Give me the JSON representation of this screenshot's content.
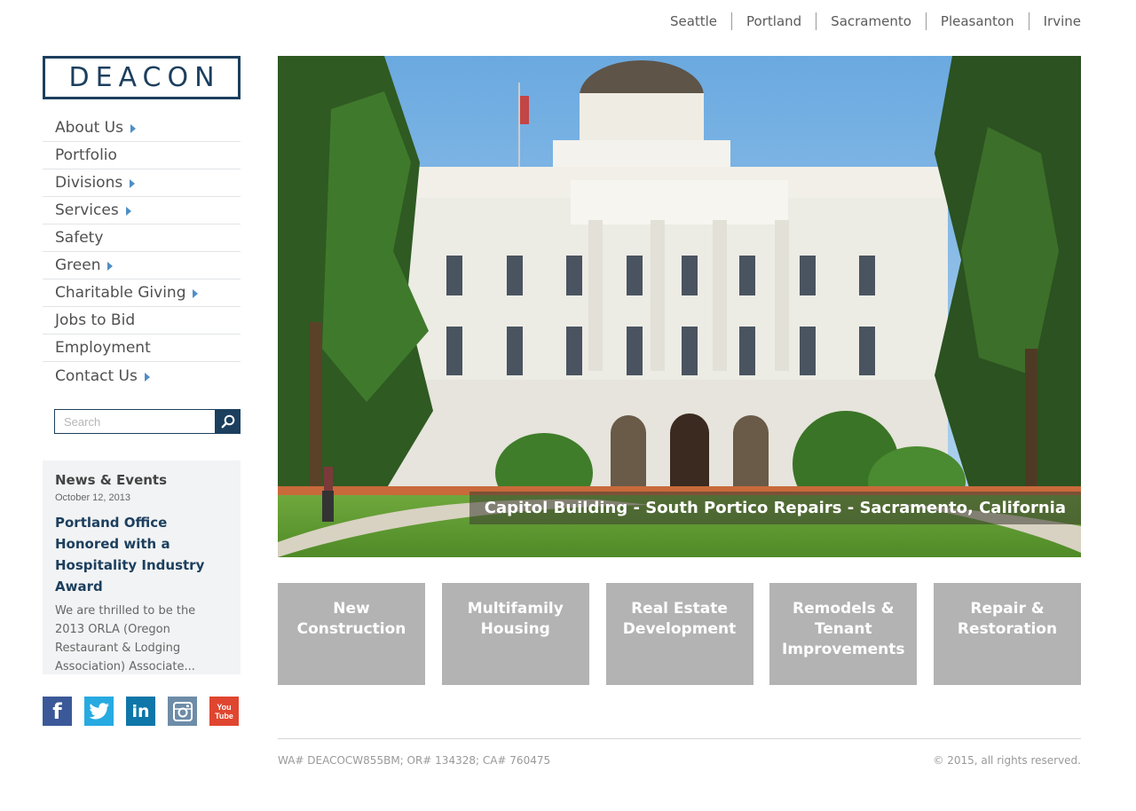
{
  "city_nav": [
    "Seattle",
    "Portland",
    "Sacramento",
    "Pleasanton",
    "Irvine"
  ],
  "logo": "DEACON",
  "sidebar": {
    "items": [
      {
        "label": "About Us",
        "has_submenu": true
      },
      {
        "label": "Portfolio",
        "has_submenu": false
      },
      {
        "label": "Divisions",
        "has_submenu": true
      },
      {
        "label": "Services",
        "has_submenu": true
      },
      {
        "label": "Safety",
        "has_submenu": false
      },
      {
        "label": "Green",
        "has_submenu": true
      },
      {
        "label": "Charitable Giving",
        "has_submenu": true
      },
      {
        "label": "Jobs to Bid",
        "has_submenu": false
      },
      {
        "label": "Employment",
        "has_submenu": false
      },
      {
        "label": "Contact Us",
        "has_submenu": true
      }
    ]
  },
  "search": {
    "placeholder": "Search",
    "value": "",
    "icon": "search-icon"
  },
  "news": {
    "title": "News & Events",
    "date": "October 12, 2013",
    "headline": "Portland Office Honored with a Hospitality Industry Award",
    "excerpt": "We are thrilled to be the 2013 ORLA (Oregon Restaurant & Lodging Association) Associate..."
  },
  "social": {
    "facebook": "f",
    "linkedin": "in",
    "youtube_top": "You",
    "youtube_bottom": "Tube"
  },
  "hero": {
    "caption": "Capitol Building - South Portico Repairs - Sacramento, California"
  },
  "tiles": [
    "New Construction",
    "Multifamily Housing",
    "Real Estate Development",
    "Remodels & Tenant Improvements",
    "Repair & Restoration"
  ],
  "footer": {
    "license": "WA# DEACOCW855BM; OR# 134328; CA# 760475",
    "copyright": "© 2015, all rights reserved."
  },
  "colors": {
    "brand_navy": "#1c3f5e",
    "arrow_blue": "#4f8ec6",
    "tile_gray": "#b3b3b3"
  }
}
